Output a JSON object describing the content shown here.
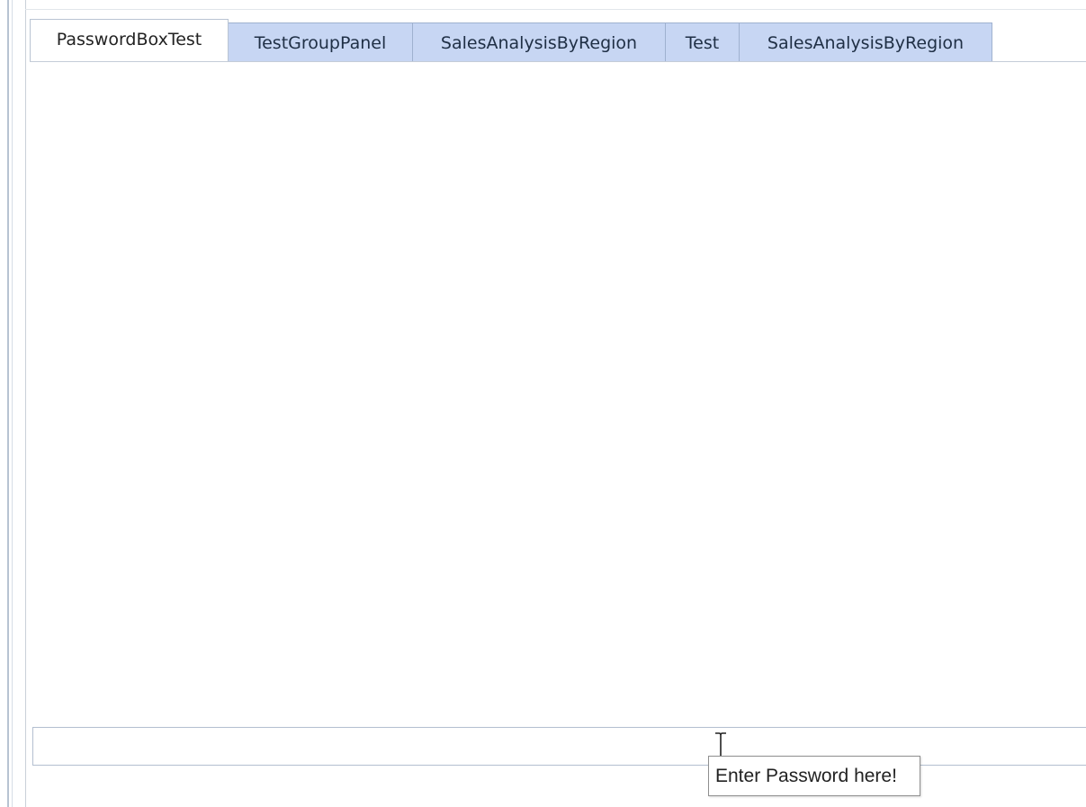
{
  "tabs": [
    {
      "label": "PasswordBoxTest",
      "selected": true
    },
    {
      "label": "TestGroupPanel",
      "selected": false
    },
    {
      "label": "SalesAnalysisByRegion",
      "selected": false
    },
    {
      "label": "Test",
      "selected": false
    },
    {
      "label": "SalesAnalysisByRegion",
      "selected": false
    }
  ],
  "password_box": {
    "value": "",
    "tooltip": "Enter Password here!"
  },
  "colors": {
    "tab_inactive": "#c7d6f3",
    "tab_active": "#ffffff",
    "tab_border": "#9fb1cf"
  },
  "icons": {
    "cursor": "i-beam-cursor-icon"
  }
}
